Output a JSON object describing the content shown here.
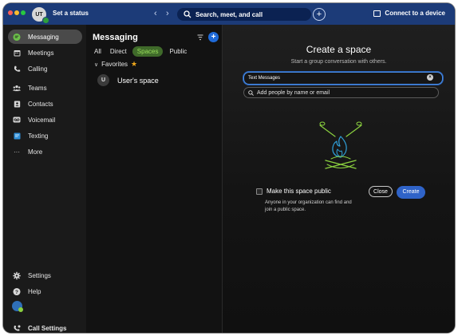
{
  "titlebar": {
    "avatar_initials": "UT",
    "status_label": "Set a status",
    "back_arrow": "‹",
    "forward_arrow": "›",
    "search_placeholder": "Search, meet, and call",
    "plus_label": "+",
    "connect_label": "Connect to a device"
  },
  "sidebar": {
    "items": [
      {
        "label": "Messaging",
        "icon": "chat-bubble-icon",
        "active": true
      },
      {
        "label": "Meetings",
        "icon": "calendar-icon"
      },
      {
        "label": "Calling",
        "icon": "phone-icon"
      },
      {
        "label": "Teams",
        "icon": "teams-icon"
      },
      {
        "label": "Contacts",
        "icon": "contacts-icon"
      },
      {
        "label": "Voicemail",
        "icon": "voicemail-icon"
      },
      {
        "label": "Texting",
        "icon": "texting-icon"
      },
      {
        "label": "More",
        "icon": "more-icon"
      }
    ],
    "bottom": {
      "settings_label": "Settings",
      "help_label": "Help",
      "call_settings_label": "Call Settings"
    }
  },
  "messaging": {
    "title": "Messaging",
    "add_label": "+",
    "tabs": [
      {
        "label": "All"
      },
      {
        "label": "Direct"
      },
      {
        "label": "Spaces",
        "selected": true
      },
      {
        "label": "Public"
      }
    ],
    "favorites_label": "Favorites",
    "spaces": [
      {
        "initial": "U",
        "name": "User's space"
      }
    ]
  },
  "create_space": {
    "title": "Create a space",
    "subtitle": "Start a group conversation with others.",
    "name_value": "Text Messages",
    "people_placeholder": "Add people by name or email",
    "public_label": "Make this space public",
    "public_description": "Anyone in your organization can find and join a public space.",
    "close_label": "Close",
    "create_label": "Create"
  },
  "colors": {
    "titlebar_bg": "#1c3b78",
    "accent_blue": "#2f63c8",
    "active_green": "#9adf5c",
    "illustration_green": "#8bd13f",
    "illustration_blue": "#2f9fd8"
  }
}
